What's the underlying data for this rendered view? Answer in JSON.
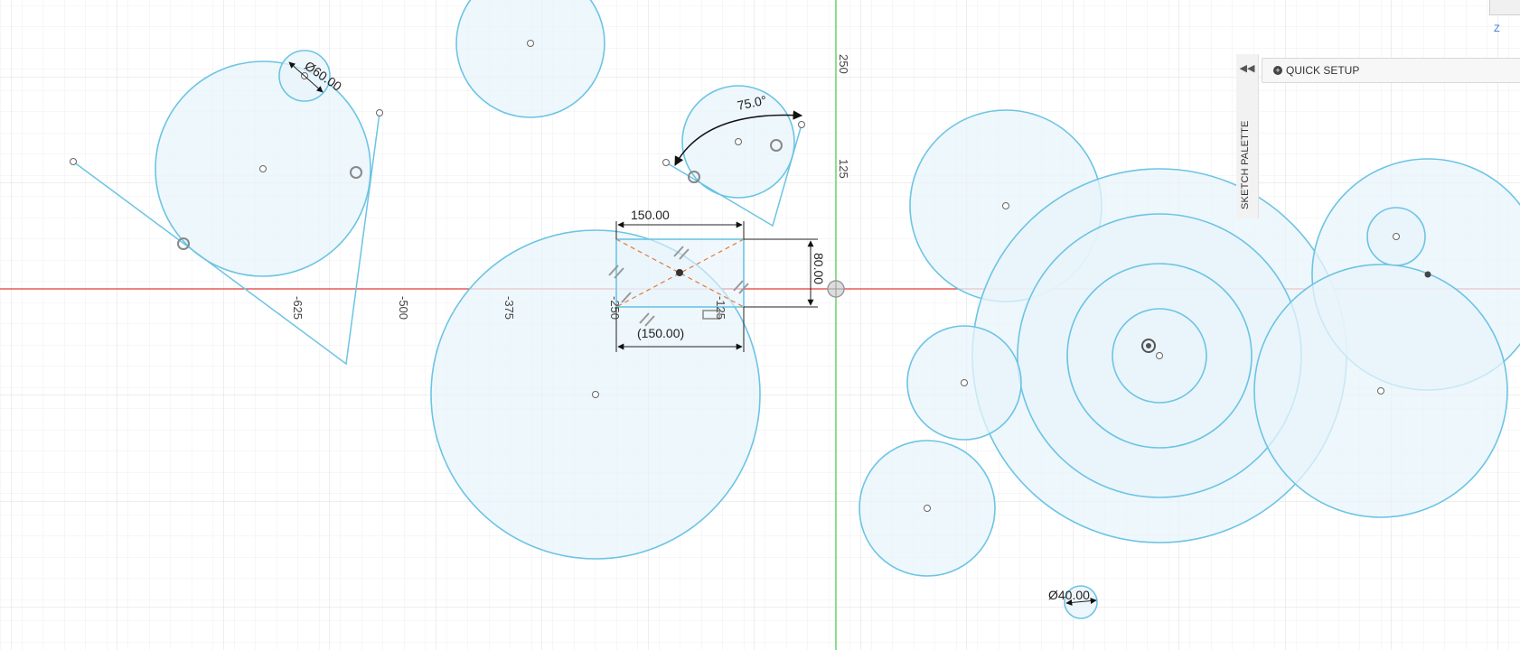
{
  "app": {
    "palette_title": "SKETCH PALETTE",
    "quick_setup_label": "QUICK SETUP",
    "collapse_icon": "double-chevron-left-icon",
    "axis_indicator": "Z"
  },
  "axis_labels": {
    "x_neg625": "-625",
    "x_neg500": "-500",
    "x_neg375": "-375",
    "x_neg250": "-250",
    "x_neg125": "-125",
    "y_250": "250",
    "y_125": "125"
  },
  "dimensions": {
    "diameter_small": "Ø60.00",
    "angle": "75.0°",
    "rect_width": "150.00",
    "rect_height": "80.00",
    "rect_width_ref": "(150.00)",
    "diameter_bottom": "Ø40.00"
  },
  "colors": {
    "sketch_line": "#6cc4e4",
    "sketch_fill": "#e8f4fb",
    "x_axis": "#e53935",
    "y_axis": "#43c943",
    "grid_major": "#dedede",
    "grid_minor": "#efefef"
  }
}
